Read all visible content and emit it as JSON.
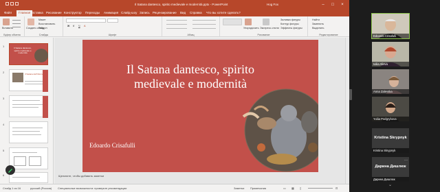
{
  "window": {
    "title": "Il Satana dantesco, spirito medievale e modernità.pptx - PowerPoint",
    "user": "Hog Fox"
  },
  "tabs": [
    "Файл",
    "Главная",
    "Вставка",
    "Рисование",
    "Конструктор",
    "Переходы",
    "Анимация",
    "Слайд-шоу",
    "Запись",
    "Рецензирование",
    "Вид",
    "Справка"
  ],
  "tell_me": "Что вы хотите сделать?",
  "ribbon": {
    "groups": [
      "Буфер обмена",
      "Слайды",
      "Шрифт",
      "Абзац",
      "Рисование",
      "Редактирование"
    ],
    "paste": "Вставить",
    "new_slide": "Создать слайд",
    "layout": "Макет",
    "reset": "Восстановить",
    "section": "Раздел",
    "arrange": "Упорядочить",
    "quick_styles": "Экспресс-стили",
    "shape_fill": "Заливка фигуры",
    "shape_outline": "Контур фигуры",
    "shape_effects": "Эффекты фигуры",
    "find": "Найти",
    "replace": "Заменить",
    "select": "Выделить"
  },
  "thumbnails": [
    {
      "num": "1",
      "title": "Il Satana dantesco, spirito medievale e modernità"
    },
    {
      "num": "2",
      "title": "Il Satana dell'Inferno"
    },
    {
      "num": "3",
      "title": ""
    },
    {
      "num": "4",
      "title": ""
    },
    {
      "num": "5",
      "title": ""
    },
    {
      "num": "6",
      "title": ""
    }
  ],
  "slide": {
    "title_line1": "Il Satana dantesco, spirito",
    "title_line2": "medievale e modernità",
    "author": "Edoardo Crisafulli",
    "notes_placeholder": "Щелкните, чтобы добавить заметки"
  },
  "status": {
    "slide": "Слайд 1 из 16",
    "language": "русский (Россия)",
    "accessibility": "Специальные возможности: проверьте рекомендации",
    "notes": "Заметки",
    "comments": "Примечания"
  },
  "participants": [
    {
      "name": "Edoardo Crisafulli",
      "active": true,
      "video": true
    },
    {
      "name": "Iuliia Alieva",
      "active": false,
      "video": true
    },
    {
      "name": "Anna Zalevska",
      "active": false,
      "video": true
    },
    {
      "name": "Yuliia Podgrybova",
      "active": false,
      "video": true
    },
    {
      "name": "Kristina Skrypnyk",
      "active": false,
      "video": false
    },
    {
      "name": "Дарина Дишлюк",
      "active": false,
      "video": false
    }
  ],
  "colors": {
    "accent": "#b7472a",
    "slide_bg": "#c2504a",
    "active_speaker": "#8bc34a"
  }
}
